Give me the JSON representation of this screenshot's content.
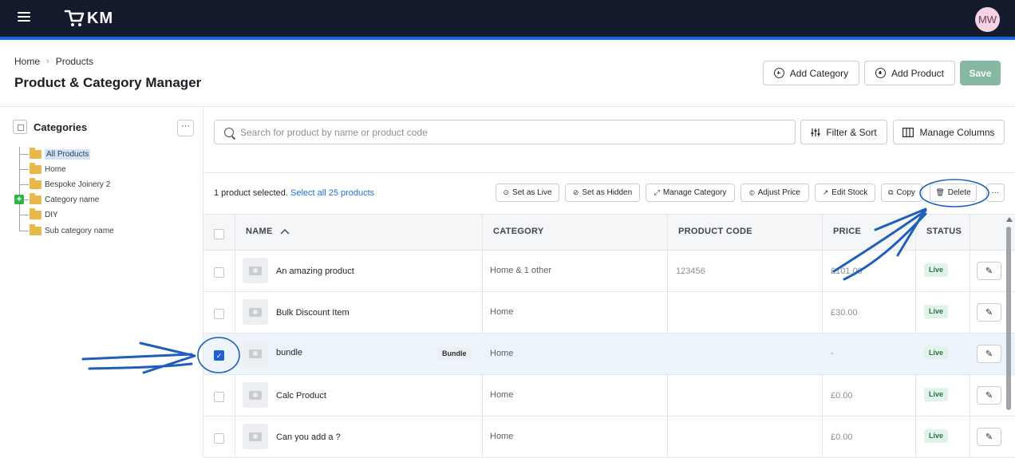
{
  "app": {
    "logo_text": "KM",
    "avatar_initials": "MW"
  },
  "breadcrumb": {
    "home": "Home",
    "separator": "›",
    "current": "Products"
  },
  "page_title": "Product & Category Manager",
  "header_buttons": {
    "add_category": "Add Category",
    "add_product": "Add Product",
    "save": "Save"
  },
  "sidebar": {
    "title": "Categories",
    "more": "···",
    "tree": [
      {
        "label": "All Products",
        "selected": true
      },
      {
        "label": "Home"
      },
      {
        "label": "Bespoke Joinery 2"
      },
      {
        "label": "Category name"
      },
      {
        "label": "DIY"
      },
      {
        "label": "Sub category name"
      }
    ],
    "add_badge": "+"
  },
  "search": {
    "placeholder": "Search for product by name or product code",
    "value": ""
  },
  "toolbar": {
    "filter_sort": "Filter & Sort",
    "manage_columns": "Manage Columns"
  },
  "selection": {
    "info": "1 product selected.",
    "select_all": "Select all 25 products",
    "actions": {
      "set_live": "Set as Live",
      "set_hidden": "Set as Hidden",
      "manage_category": "Manage Category",
      "adjust_price": "Adjust Price",
      "edit_stock": "Edit Stock",
      "copy": "Copy",
      "delete": "Delete",
      "more": "···"
    }
  },
  "table": {
    "columns": {
      "name": "NAME",
      "sort_indicator": "^",
      "category": "CATEGORY",
      "product_code": "PRODUCT CODE",
      "price": "PRICE",
      "status": "STATUS"
    },
    "rows": [
      {
        "name": "An amazing product",
        "category": "Home & 1",
        "category_extra": "other",
        "product_code": "123456",
        "price": "£101.00",
        "status": "Live",
        "checked": false,
        "tag": ""
      },
      {
        "name": "Bulk Discount Item",
        "category": "Home",
        "category_extra": "",
        "product_code": "",
        "price": "£30.00",
        "status": "Live",
        "checked": false,
        "tag": ""
      },
      {
        "name": "bundle",
        "category": "Home",
        "category_extra": "",
        "product_code": "",
        "price": "-",
        "status": "Live",
        "checked": true,
        "tag": "Bundle"
      },
      {
        "name": "Calc Product",
        "category": "Home",
        "category_extra": "",
        "product_code": "",
        "price": "£0.00",
        "status": "Live",
        "checked": false,
        "tag": ""
      },
      {
        "name": "Can you add a ?",
        "category": "Home",
        "category_extra": "",
        "product_code": "",
        "price": "£0.00",
        "status": "Live",
        "checked": false,
        "tag": ""
      }
    ]
  },
  "colors": {
    "topbar": "#141b2d",
    "accent": "#1668d4",
    "annotation": "#1f5fb8",
    "live_bg": "#e1f3e8",
    "live_text": "#227847"
  }
}
